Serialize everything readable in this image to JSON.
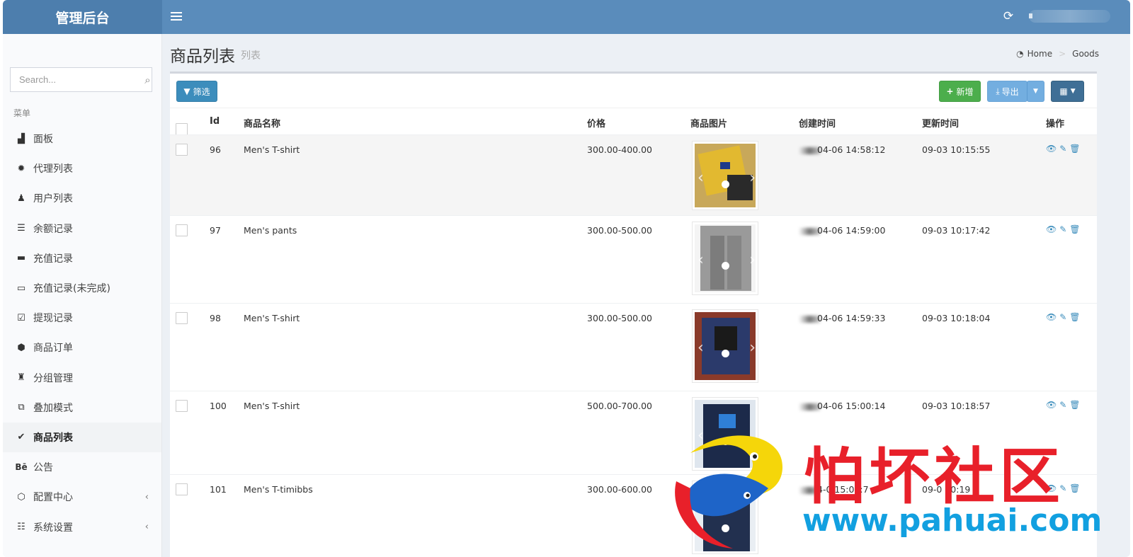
{
  "header": {
    "logo": "管理后台"
  },
  "sidebar": {
    "search_placeholder": "Search...",
    "menu_header": "菜单",
    "items": [
      {
        "label": "面板",
        "icon": "area-chart-icon"
      },
      {
        "label": "代理列表",
        "icon": "gear-icon"
      },
      {
        "label": "用户列表",
        "icon": "user-icon"
      },
      {
        "label": "余额记录",
        "icon": "list-icon"
      },
      {
        "label": "充值记录",
        "icon": "battery-full-icon"
      },
      {
        "label": "充值记录(未完成)",
        "icon": "battery-empty-icon"
      },
      {
        "label": "提现记录",
        "icon": "check-square-icon"
      },
      {
        "label": "商品订单",
        "icon": "cube-icon"
      },
      {
        "label": "分组管理",
        "icon": "users-icon"
      },
      {
        "label": "叠加模式",
        "icon": "object-group-icon"
      },
      {
        "label": "商品列表",
        "icon": "vine-icon",
        "active": true
      },
      {
        "label": "公告",
        "icon": "behance-icon"
      },
      {
        "label": "配置中心",
        "icon": "hexagon-icon",
        "expandable": true
      },
      {
        "label": "系统设置",
        "icon": "server-icon",
        "expandable": true
      }
    ]
  },
  "page": {
    "title": "商品列表",
    "subtitle": "列表"
  },
  "breadcrumb": {
    "home": "Home",
    "current": "Goods"
  },
  "toolbar": {
    "filter": "筛选",
    "add": "新增",
    "export": "导出"
  },
  "table": {
    "headers": {
      "id": "Id",
      "name": "商品名称",
      "price": "价格",
      "image": "商品图片",
      "created": "创建时间",
      "updated": "更新时间",
      "ops": "操作"
    },
    "rows": [
      {
        "id": "96",
        "name": "Men's T-shirt",
        "price": "300.00-400.00",
        "created": "04-06 14:58:12",
        "updated": "09-03 10:15:55"
      },
      {
        "id": "97",
        "name": "Men's pants",
        "price": "300.00-500.00",
        "created": "04-06 14:59:00",
        "updated": "09-03 10:17:42"
      },
      {
        "id": "98",
        "name": "Men's T-shirt",
        "price": "300.00-500.00",
        "created": "04-06 14:59:33",
        "updated": "09-03 10:18:04"
      },
      {
        "id": "100",
        "name": "Men's T-shirt",
        "price": "500.00-700.00",
        "created": "04-06 15:00:14",
        "updated": "09-03 10:18:57"
      },
      {
        "id": "101",
        "name": "Men's T-timibbs",
        "price": "300.00-600.00",
        "created": "4-0 15:00:7",
        "updated": "09-0 10:19"
      }
    ]
  },
  "watermark": {
    "text": "怕坏社区",
    "url": "www.pahuai.com"
  }
}
